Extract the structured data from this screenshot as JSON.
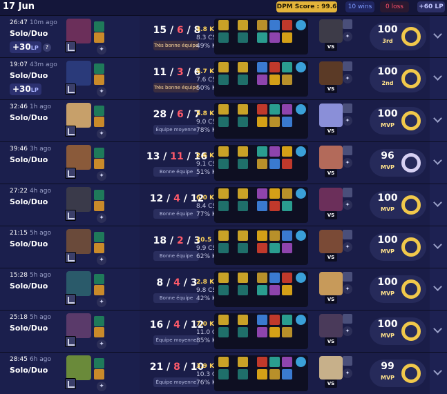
{
  "header": {
    "date": "17 Jun",
    "dpm_score": "DPM Score : 99.6",
    "wins": "10 wins",
    "loss": "0 loss",
    "lp": "+60 LP"
  },
  "matches": [
    {
      "duration": "26:47",
      "ago": "10m ago",
      "queue": "Solo/Duo",
      "lp": "+30",
      "lp_unit": "LP",
      "k": "15",
      "d": "6",
      "a": "8",
      "tag": "Très bonne équipe",
      "tag_style": "tbe",
      "kpart": "3.8 K",
      "cs": "8.3 CS",
      "pct": "49% K",
      "score": "100",
      "rank": "3rd",
      "ring": "gold",
      "champ_color": "#6b2f5a",
      "opp_color": "#3d3b48"
    },
    {
      "duration": "19:07",
      "ago": "43m ago",
      "queue": "Solo/Duo",
      "lp": "+30",
      "lp_unit": "LP",
      "k": "11",
      "d": "3",
      "a": "6",
      "tag": "Très bonne équipe",
      "tag_style": "tbe",
      "kpart": "5.7 K",
      "cs": "7.6 CS",
      "pct": "50% K",
      "score": "100",
      "rank": "2nd",
      "ring": "gold",
      "champ_color": "#2a3a7a",
      "opp_color": "#5b3a26"
    },
    {
      "duration": "32:46",
      "ago": "1h ago",
      "queue": "Solo/Duo",
      "lp": "",
      "lp_unit": "",
      "k": "28",
      "d": "6",
      "a": "7",
      "tag": "Équipe moyenne",
      "tag_style": "",
      "kpart": "5.8 K",
      "cs": "9.0 CS",
      "pct": "78% K",
      "score": "100",
      "rank": "MVP",
      "ring": "gold",
      "champ_color": "#c7a06a",
      "opp_color": "#8a8fd8"
    },
    {
      "duration": "39:46",
      "ago": "3h ago",
      "queue": "Solo/Duo",
      "lp": "",
      "lp_unit": "",
      "k": "13",
      "d": "11",
      "a": "16",
      "tag": "Bonne équipe",
      "tag_style": "",
      "kpart": "2.6 K",
      "cs": "9.1 CS",
      "pct": "51% K",
      "score": "96",
      "rank": "MVP",
      "ring": "silver",
      "champ_color": "#8a5a3a",
      "opp_color": "#b36a5a"
    },
    {
      "duration": "27:22",
      "ago": "4h ago",
      "queue": "Solo/Duo",
      "lp": "",
      "lp_unit": "",
      "k": "12",
      "d": "4",
      "a": "12",
      "tag": "Bonne équipe",
      "tag_style": "",
      "kpart": "6.0 K",
      "cs": "8.4 CS",
      "pct": "77% K",
      "score": "100",
      "rank": "MVP",
      "ring": "gold",
      "champ_color": "#3a3a4a",
      "opp_color": "#6b2f5a"
    },
    {
      "duration": "21:15",
      "ago": "5h ago",
      "queue": "Solo/Duo",
      "lp": "",
      "lp_unit": "",
      "k": "18",
      "d": "2",
      "a": "3",
      "tag": "Bonne équipe",
      "tag_style": "",
      "kpart": "10.5 K",
      "cs": "9.9 CS",
      "pct": "62% K",
      "score": "100",
      "rank": "MVP",
      "ring": "gold",
      "champ_color": "#6a4a3a",
      "opp_color": "#7a4a36"
    },
    {
      "duration": "15:28",
      "ago": "5h ago",
      "queue": "Solo/Duo",
      "lp": "",
      "lp_unit": "",
      "k": "8",
      "d": "4",
      "a": "3",
      "tag": "Bonne équipe",
      "tag_style": "",
      "kpart": "2.8 K",
      "cs": "9.8 CS",
      "pct": "42% K",
      "score": "100",
      "rank": "MVP",
      "ring": "gold",
      "champ_color": "#2a5a6a",
      "opp_color": "#c79a5a"
    },
    {
      "duration": "25:18",
      "ago": "5h ago",
      "queue": "Solo/Duo",
      "lp": "",
      "lp_unit": "",
      "k": "16",
      "d": "4",
      "a": "12",
      "tag": "Équipe moyenne",
      "tag_style": "",
      "kpart": "7.0 K",
      "cs": "11.0 C",
      "pct": "85% K",
      "score": "100",
      "rank": "MVP",
      "ring": "gold",
      "champ_color": "#5a3a6a",
      "opp_color": "#4a3a5a"
    },
    {
      "duration": "28:45",
      "ago": "6h ago",
      "queue": "Solo/Duo",
      "lp": "",
      "lp_unit": "",
      "k": "21",
      "d": "8",
      "a": "10",
      "tag": "Équipe moyenne",
      "tag_style": "",
      "kpart": "3.9 K",
      "cs": "10.3 C",
      "pct": "76% K",
      "score": "99",
      "rank": "MVP",
      "ring": "gold",
      "champ_color": "#6a8a3a",
      "opp_color": "#c7b08a"
    }
  ]
}
